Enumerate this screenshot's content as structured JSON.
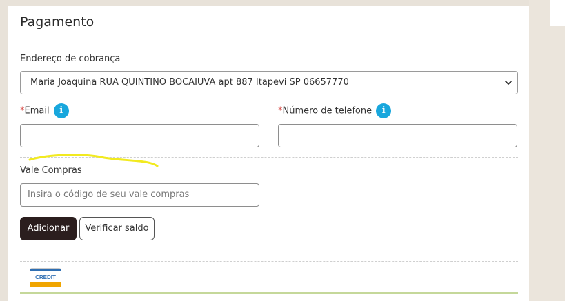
{
  "page": {
    "title": "Pagamento"
  },
  "billing": {
    "label": "Endereço de cobrança",
    "selected_address": "Maria Joaquina RUA QUINTINO BOCAIUVA apt 887 Itapevi SP 06657770"
  },
  "email": {
    "required_mark": "*",
    "label": "Email",
    "value": "",
    "info_glyph": "i"
  },
  "phone": {
    "required_mark": "*",
    "label": "Número de telefone",
    "value": "",
    "info_glyph": "i"
  },
  "voucher": {
    "label": "Vale Compras",
    "placeholder": "Insira o código de seu vale compras",
    "add_button": "Adicionar",
    "check_balance_button": "Verificar saldo"
  },
  "payment_methods": {
    "card_label": "CREDIT"
  },
  "colors": {
    "info_icon": "#18a7dd",
    "dark_button": "#2b1e1e",
    "highlight_stroke": "#f2ea1f",
    "accent_line": "#c5d89a"
  },
  "icons": [
    "info-icon",
    "chevron-down-icon",
    "credit-card-icon"
  ]
}
